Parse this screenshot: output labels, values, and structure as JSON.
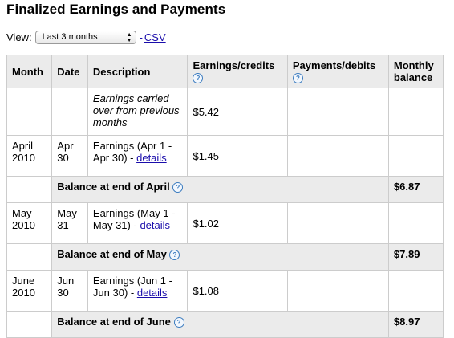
{
  "page": {
    "title": "Finalized Earnings and Payments"
  },
  "view": {
    "label": "View:",
    "selected": "Last 3 months",
    "csv_dash": "-",
    "csv_link": "CSV"
  },
  "table": {
    "headers": {
      "month": "Month",
      "date": "Date",
      "description": "Description",
      "earnings": "Earnings/credits",
      "payments": "Payments/debits",
      "balance_line1": "Monthly",
      "balance_line2": "balance"
    },
    "carried": {
      "description": "Earnings carried over from previous months",
      "earnings": "$5.42"
    },
    "months": [
      {
        "month": "April 2010",
        "date": "Apr 30",
        "description": "Earnings (Apr 1 - Apr 30) -",
        "details": "details",
        "earnings": "$1.45",
        "balance_label": "Balance at end of April",
        "balance": "$6.87"
      },
      {
        "month": "May 2010",
        "date": "May 31",
        "description": "Earnings (May 1 - May 31) -",
        "details": "details",
        "earnings": "$1.02",
        "balance_label": "Balance at end of May",
        "balance": "$7.89"
      },
      {
        "month": "June 2010",
        "date": "Jun 30",
        "description": "Earnings (Jun 1 - Jun 30) -",
        "details": "details",
        "earnings": "$1.08",
        "balance_label": "Balance at end of June",
        "balance": "$8.97"
      }
    ]
  },
  "icons": {
    "help": "question-mark-help-icon",
    "select_arrows": "up-down-arrows-icon"
  },
  "colors": {
    "link": "#1a0dab",
    "header_bg": "#ebebeb",
    "help_icon": "#3b7bbf"
  }
}
